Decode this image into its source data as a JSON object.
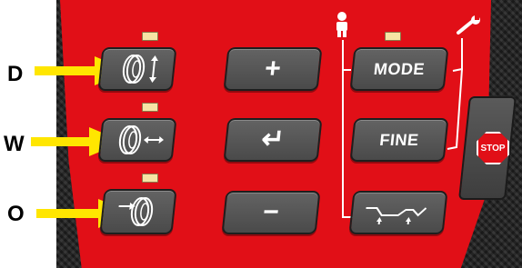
{
  "side_letters": [
    "D",
    "W",
    "O"
  ],
  "buttons": {
    "plus": "+",
    "enter": "↵",
    "minus": "−",
    "mode": "MODE",
    "fine": "FINE",
    "stop": "STOP"
  },
  "icons": {
    "wheel_vertical": "wheel-vertical-arrow-icon",
    "wheel_horizontal": "wheel-horizontal-arrow-icon",
    "wheel_offset": "wheel-offset-arrow-icon",
    "operator": "person-icon",
    "service": "wrench-icon",
    "balancing_mode": "wheel-profile-icon"
  },
  "colors": {
    "panel_red": "#e10f17",
    "key_gray": "#555555",
    "arrow_yellow": "#ffe600",
    "led_yellow": "#f7e3a4"
  }
}
